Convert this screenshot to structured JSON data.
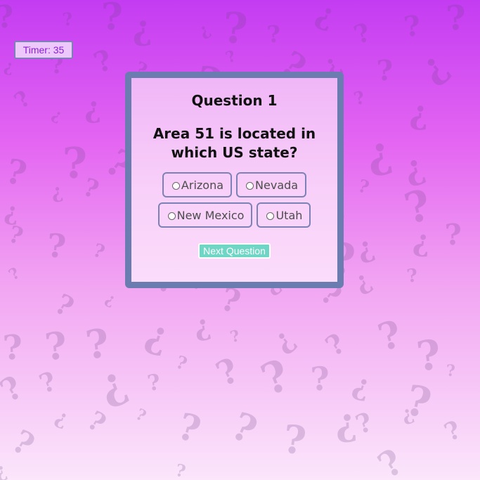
{
  "timer": {
    "label": "Timer:",
    "value": "35"
  },
  "quiz": {
    "title": "Question 1",
    "question": "Area 51 is located in which US state?",
    "answers": [
      {
        "label": "Arizona"
      },
      {
        "label": "Nevada"
      },
      {
        "label": "New Mexico"
      },
      {
        "label": "Utah"
      }
    ],
    "next_button": "Next Question"
  },
  "background": {
    "pattern_glyph": "?",
    "alt_glyph": "¿",
    "colors": {
      "top": "#c43cf2",
      "bottom": "#fbe6fb",
      "card_border": "#6a7cb0",
      "button": "#6fd6c6",
      "timer_text": "#8a1fd6"
    }
  },
  "icons": {
    "radio": "radio-unchecked-icon"
  }
}
